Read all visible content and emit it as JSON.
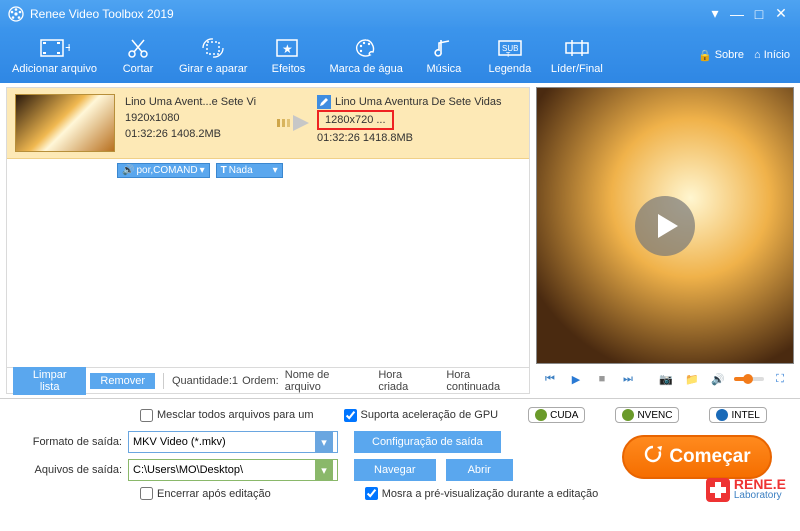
{
  "title": "Renee Video Toolbox 2019",
  "toolbar": {
    "items": [
      {
        "label": "Adicionar arquivo"
      },
      {
        "label": "Cortar"
      },
      {
        "label": "Girar e aparar"
      },
      {
        "label": "Efeitos"
      },
      {
        "label": "Marca de água"
      },
      {
        "label": "Música"
      },
      {
        "label": "Legenda"
      },
      {
        "label": "Líder/Final"
      }
    ],
    "about": "Sobre",
    "home": "Início"
  },
  "file": {
    "src_name": "Lino Uma Avent...e Sete Vi",
    "src_res": "1920x1080",
    "src_stats": "01:32:26  1408.2MB",
    "dst_name": "Lino Uma Aventura De Sete Vidas",
    "dst_res": "1280x720   ...",
    "dst_stats": "01:32:26  1418.8MB",
    "audio_opt": "por,COMAND",
    "subtitle_opt": "Nada"
  },
  "listbar": {
    "clear": "Limpar lista",
    "remove": "Remover",
    "qty_label": "Quantidade:1",
    "order_label": "Ordem:",
    "order_name": "Nome de arquivo",
    "order_created": "Hora criada",
    "order_cont": "Hora continuada"
  },
  "options": {
    "merge": "Mesclar todos arquivos para um",
    "gpu": "Suporta aceleração de GPU",
    "badges": {
      "cuda": "CUDA",
      "nvenc": "NVENC",
      "intel": "INTEL"
    },
    "format_label": "Formato de saída:",
    "format_value": "MKV Video (*.mkv)",
    "output_label": "Aquivos de saída:",
    "output_value": "C:\\Users\\MO\\Desktop\\",
    "config": "Configuração de saída",
    "browse": "Navegar",
    "open": "Abrir",
    "close_after": "Encerrar após editação",
    "preview_during": "Mosra a pré-visualização durante a editação",
    "start": "Começar"
  },
  "brand": {
    "name": "RENE.E",
    "sub": "Laboratory"
  }
}
